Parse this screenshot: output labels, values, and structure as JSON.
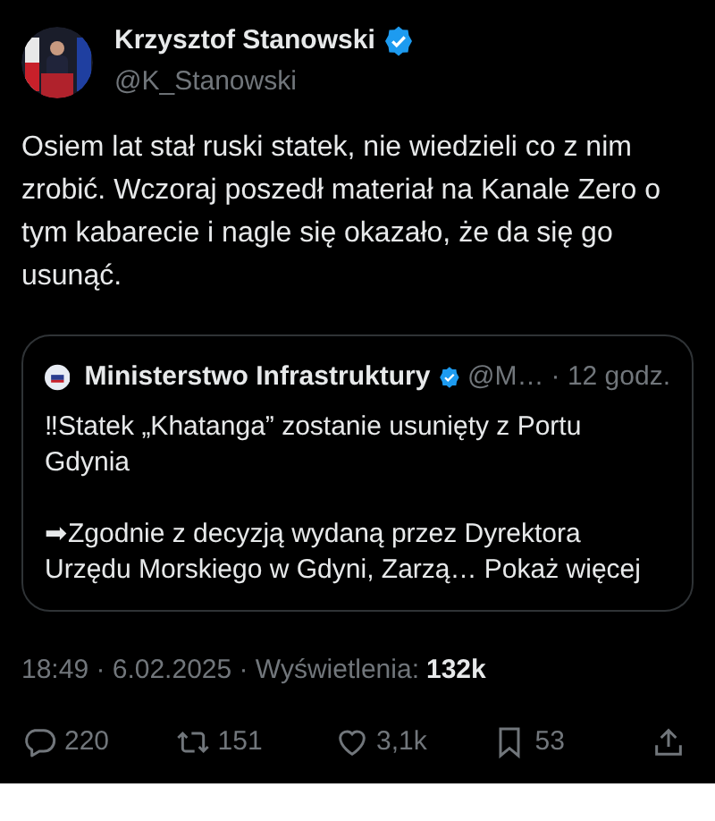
{
  "author": {
    "name": "Krzysztof Stanowski",
    "handle": "@K_Stanowski",
    "verified": true
  },
  "text": "Osiem lat stał ruski statek, nie wiedzieli co z nim zrobić. Wczoraj poszedł materiał na Kanale Zero o tym kabarecie i nagle się okazało, że da się go usunąć.",
  "quote": {
    "name": "Ministerstwo Infrastruktury",
    "verified": true,
    "handle": "@M…",
    "time": "· 12 godz.",
    "paragraphs": [
      {
        "text": "‼Statek „Khatanga” zostanie usunięty z Portu Gdynia"
      },
      {
        "text": "➡Zgodnie z decyzją wydaną przez Dyrektora Urzędu Morskiego w Gdyni, Zarzą…",
        "more": "Pokaż więcej"
      }
    ]
  },
  "meta": {
    "time": "18:49 · 6.02.2025 · Wyświetlenia:",
    "views": "132k"
  },
  "actions": [
    {
      "kind": "reply",
      "count": "220"
    },
    {
      "kind": "repost",
      "count": "151"
    },
    {
      "kind": "like",
      "count": "3,1k"
    },
    {
      "kind": "bookmark",
      "count": "53"
    },
    {
      "kind": "share"
    }
  ]
}
